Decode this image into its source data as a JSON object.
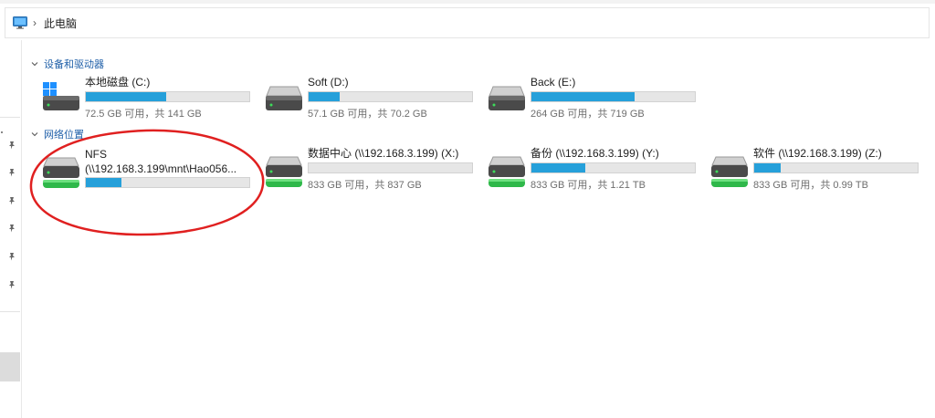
{
  "address_bar": {
    "separator": "›",
    "location": "此电脑"
  },
  "sections": {
    "devices_title": "设备和驱动器",
    "network_title": "网络位置"
  },
  "drives": [
    {
      "name": "本地磁盘 (C:)",
      "info": "72.5 GB 可用，共 141 GB",
      "used_fraction": 0.49,
      "icon": "windows-drive-icon"
    },
    {
      "name": "Soft (D:)",
      "info": "57.1 GB 可用，共 70.2 GB",
      "used_fraction": 0.19,
      "icon": "hard-drive-icon"
    },
    {
      "name": "Back (E:)",
      "info": "264 GB 可用，共 719 GB",
      "used_fraction": 0.63,
      "icon": "hard-drive-icon"
    }
  ],
  "network": [
    {
      "name_line1": "NFS",
      "name_line2": "(\\\\192.168.3.199\\mnt\\Hao056...",
      "used_fraction": 0.22,
      "icon": "network-drive-icon"
    },
    {
      "name": "数据中心 (\\\\192.168.3.199) (X:)",
      "info": "833 GB 可用，共 837 GB",
      "used_fraction": 0.0,
      "icon": "network-drive-icon"
    },
    {
      "name": "备份 (\\\\192.168.3.199) (Y:)",
      "info": "833 GB 可用，共 1.21 TB",
      "used_fraction": 0.33,
      "icon": "network-drive-icon"
    },
    {
      "name": "软件 (\\\\192.168.3.199) (Z:)",
      "info": "833 GB 可用，共 0.99 TB",
      "used_fraction": 0.16,
      "icon": "network-drive-icon"
    }
  ],
  "colors": {
    "bar_fill": "#26a0da",
    "bar_track": "#e6e6e6",
    "section_header": "#1f5fa8",
    "annotation": "#e02020"
  }
}
